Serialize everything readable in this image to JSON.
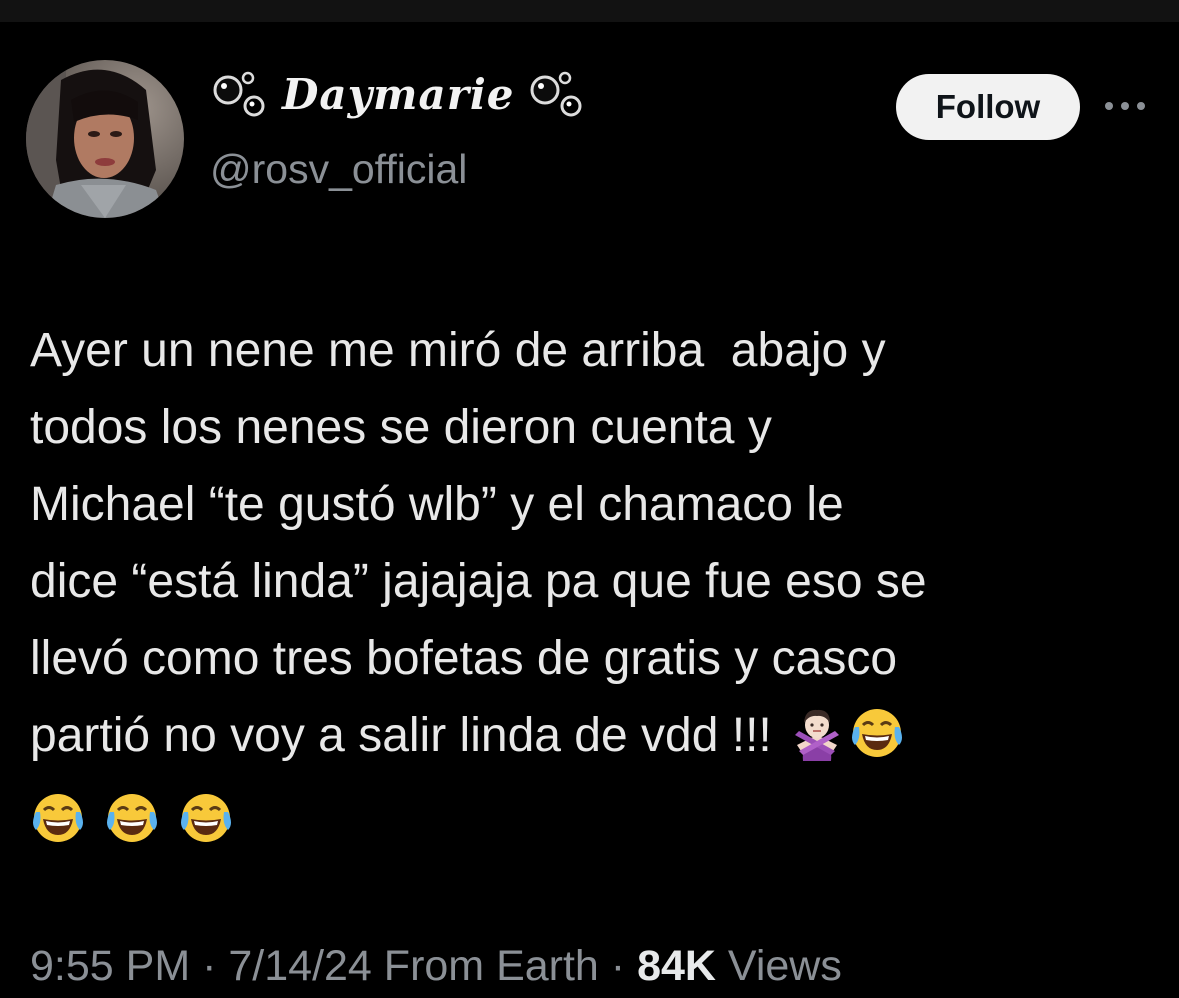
{
  "author": {
    "display_name": "Daymarie",
    "handle": "@rosv_official",
    "avatar_icon": "avatar-photo",
    "name_decoration_icon": "bubbles-icon"
  },
  "follow_button": {
    "label": "Follow"
  },
  "more_icon": "more-horizontal-icon",
  "tweet": {
    "lines": [
      "Ayer un nene me miró de arriba  abajo y",
      "todos los nenes se dieron cuenta y",
      "Michael “te gustó wlb” y el chamaco le",
      "dice “está linda” jajajaja pa que fue eso se",
      "llevó como tres bofetas de gratis y casco",
      "partió no voy a salir linda de vdd !!!"
    ],
    "emoji": [
      "🙅🏻‍♀️",
      "😂",
      "😂",
      "😂",
      "😂"
    ]
  },
  "meta": {
    "time": "9:55 PM",
    "separator": "·",
    "date": "7/14/24",
    "source": "From Earth",
    "views_count": "84K",
    "views_label": "Views"
  },
  "colors": {
    "background": "#000000",
    "text": "#e7e9ea",
    "secondary": "#8b9096",
    "button_bg": "#f2f2f2"
  }
}
